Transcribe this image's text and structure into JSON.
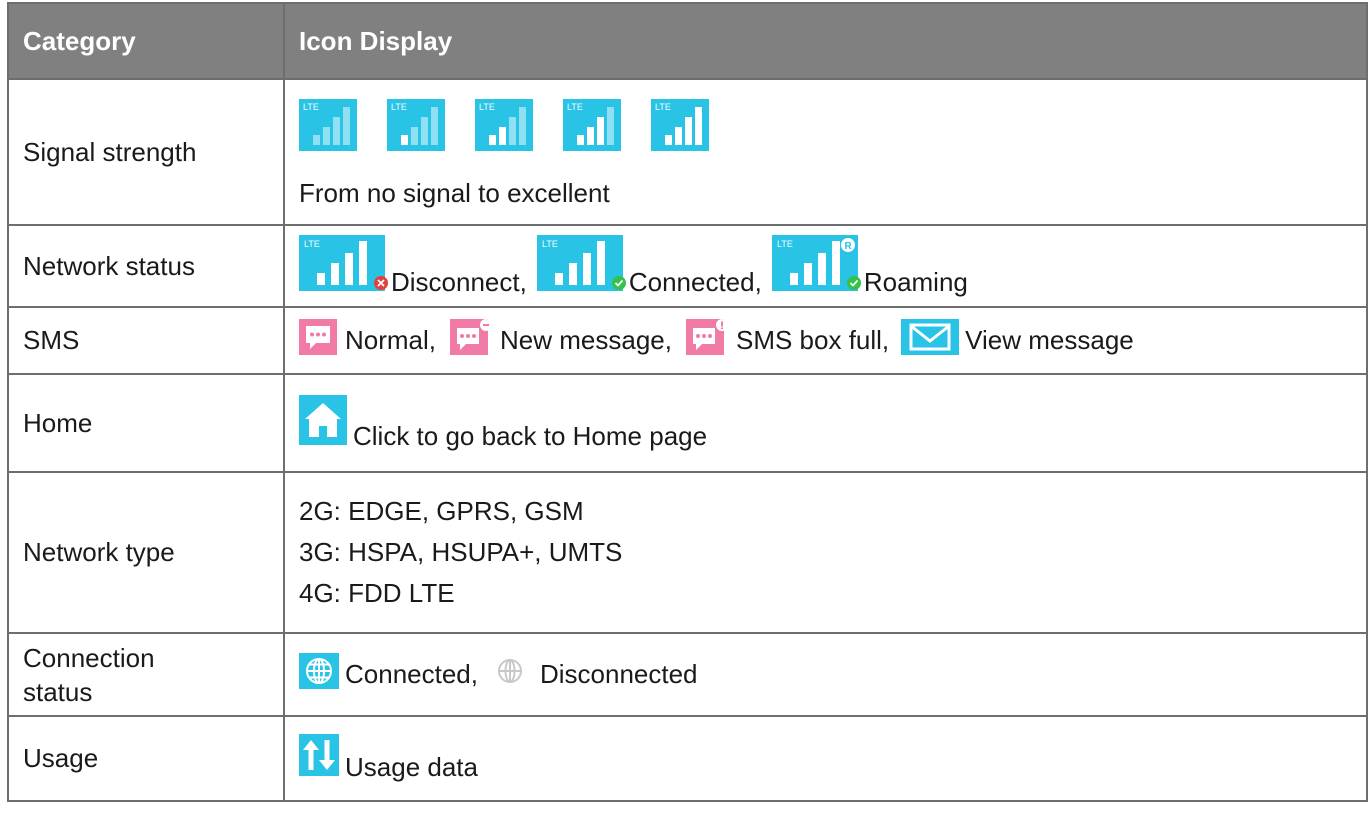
{
  "header": {
    "category": "Category",
    "icon_display": "Icon Display"
  },
  "rows": {
    "signal": {
      "category": "Signal strength",
      "icon_label": "LTE",
      "levels": [
        0,
        0.25,
        0.5,
        0.75,
        1
      ],
      "caption": "From no signal to excellent"
    },
    "network_status": {
      "category": "Network status",
      "disconnect": "Disconnect,",
      "connected": "Connected,",
      "roaming": "Roaming",
      "roam_badge": "R"
    },
    "sms": {
      "category": "SMS",
      "normal": "Normal,",
      "new_message": "New message,",
      "box_full": "SMS box full,",
      "view_message": "View message"
    },
    "home": {
      "category": "Home",
      "desc": "Click to go back to Home page"
    },
    "network_type": {
      "category": "Network type",
      "g2": "2G: EDGE, GPRS, GSM",
      "g3": "3G: HSPA, HSUPA+, UMTS",
      "g4": "4G: FDD LTE"
    },
    "connection": {
      "category_line1": "Connection",
      "category_line2": "status",
      "connected": "Connected,",
      "disconnected": "Disconnected"
    },
    "usage": {
      "category": "Usage",
      "desc": "Usage data"
    }
  },
  "colors": {
    "cyan": "#29c3e6",
    "bar_dim": "#8fe0f2",
    "bar_on": "#ffffff",
    "pink": "#f27aa6",
    "red": "#e0413c",
    "green": "#35c24a",
    "header_bg": "#808080",
    "globe_off": "#c8c8c8"
  }
}
